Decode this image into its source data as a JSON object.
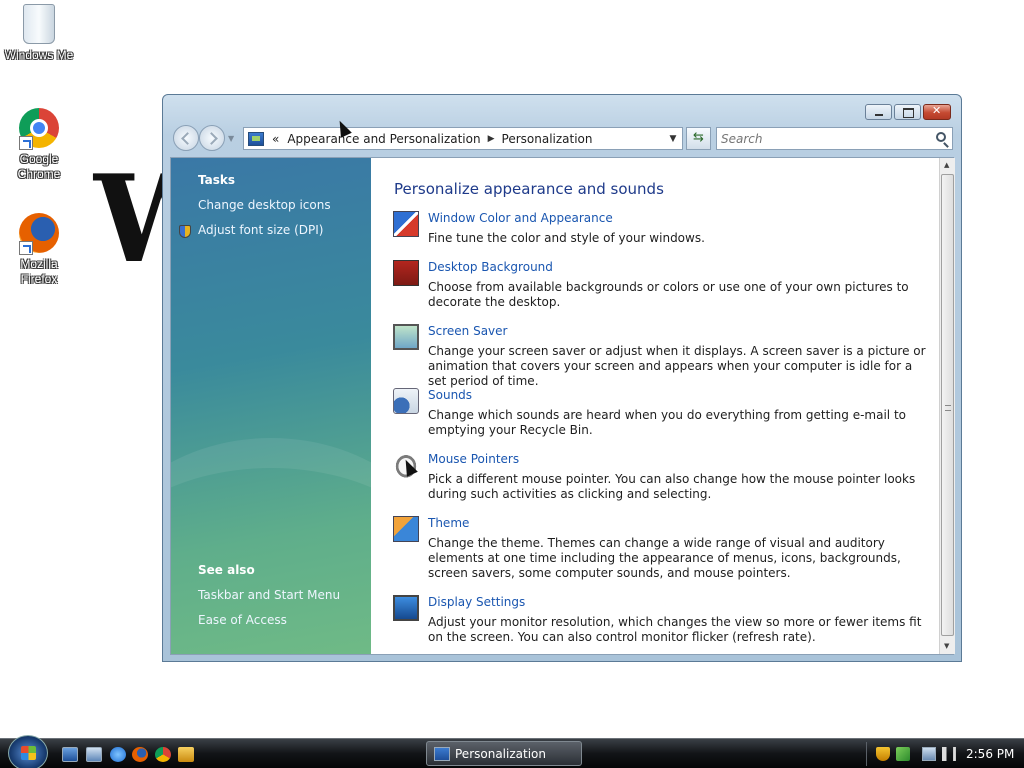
{
  "desktop": {
    "icons": [
      {
        "label": "Windows Me"
      },
      {
        "label": "Google Chrome"
      },
      {
        "label": "Mozilla Firefox"
      }
    ],
    "background_letter": "W"
  },
  "window": {
    "address": {
      "overflow": "«",
      "crumbs": [
        "Appearance and Personalization",
        "Personalization"
      ]
    },
    "search_placeholder": "Search",
    "left_pane": {
      "tasks_heading": "Tasks",
      "tasks": [
        "Change desktop icons",
        "Adjust font size (DPI)"
      ],
      "see_also_heading": "See also",
      "see_also": [
        "Taskbar and Start Menu",
        "Ease of Access"
      ]
    },
    "main": {
      "title": "Personalize appearance and sounds",
      "items": [
        {
          "title": "Window Color and Appearance",
          "desc": "Fine tune the color and style of your windows.",
          "icon": "window-color-icon"
        },
        {
          "title": "Desktop Background",
          "desc": "Choose from available backgrounds or colors or use one of your own pictures to decorate the desktop.",
          "icon": "desktop-background-icon"
        },
        {
          "title": "Screen Saver",
          "desc": "Change your screen saver or adjust when it displays. A screen saver is a picture or animation that covers your screen and appears when your computer is idle for a set period of time.",
          "icon": "screen-saver-icon"
        },
        {
          "title": "Sounds",
          "desc": "Change which sounds are heard when you do everything from getting e-mail to emptying your Recycle Bin.",
          "icon": "sounds-icon"
        },
        {
          "title": "Mouse Pointers",
          "desc": "Pick a different mouse pointer. You can also change how the mouse pointer looks during such activities as clicking and selecting.",
          "icon": "mouse-pointers-icon"
        },
        {
          "title": "Theme",
          "desc": "Change the theme. Themes can change a wide range of visual and auditory elements at one time including the appearance of menus, icons, backgrounds, screen savers, some computer sounds, and mouse pointers.",
          "icon": "theme-icon"
        },
        {
          "title": "Display Settings",
          "desc": "Adjust your monitor resolution, which changes the view so more or fewer items fit on the screen. You can also control monitor flicker (refresh rate).",
          "icon": "display-settings-icon"
        }
      ]
    }
  },
  "taskbar": {
    "active_task": "Personalization",
    "clock": "2:56 PM"
  },
  "colors": {
    "link": "#1a56b0",
    "title": "#1e3a8a",
    "left_pane_top": "#3a78a6",
    "left_pane_bottom": "#6fba86"
  }
}
